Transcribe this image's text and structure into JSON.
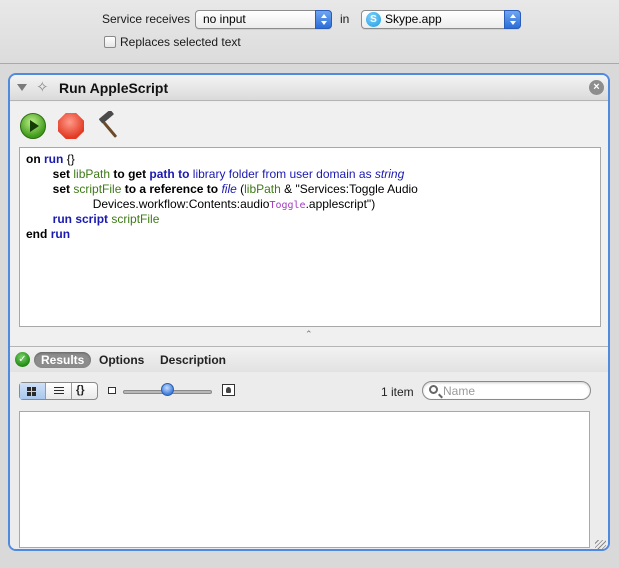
{
  "service": {
    "receives_label": "Service receives",
    "input_value": "no input",
    "in_label": "in",
    "app_value": "Skype.app",
    "replaces_label": "Replaces selected text",
    "replaces_checked": false
  },
  "action": {
    "title": "Run AppleScript",
    "icons": [
      "disclosure-triangle-icon",
      "script-icon",
      "close-icon",
      "run-icon",
      "stop-icon",
      "hammer-icon"
    ],
    "code_tokens": {
      "l1_on": "on",
      "l1_run": "run",
      "l1_braces": " {}",
      "l2_set": "set",
      "l2_libPath": "libPath",
      "l2_to_get": "to get",
      "l2_path": "path",
      "l2_to": "to",
      "l2_library_folder": "library folder",
      "l2_from": "from",
      "l2_user_domain": "user domain",
      "l2_as": "as",
      "l2_string": "string",
      "l3_set": "set",
      "l3_scriptFile": "scriptFile",
      "l3_to_a_reference_to": "to a reference to",
      "l3_file": "file",
      "l3_paren": " (",
      "l3_libPath": "libPath",
      "l3_amp_str": " & \"Services:Toggle Audio",
      "l4_str": "Devices.workflow:Contents:audio",
      "l4_toggle": "Toggle",
      "l4_end": ".applescript\")",
      "l5_run_script": "run script",
      "l5_scriptFile": "scriptFile",
      "l6_end": "end",
      "l6_run": "run"
    }
  },
  "results": {
    "tabs": [
      "Results",
      "Options",
      "Description"
    ],
    "active_tab": "Results",
    "item_count": "1 item",
    "search_placeholder": "Name",
    "view_modes": [
      "grid-icon",
      "list-icon",
      "braces-icon"
    ],
    "zoom_level": 0.5
  },
  "colors": {
    "accent": "#4f8ae0",
    "keyword_blue": "#1a1ab0",
    "variable_green": "#3d7a16"
  }
}
